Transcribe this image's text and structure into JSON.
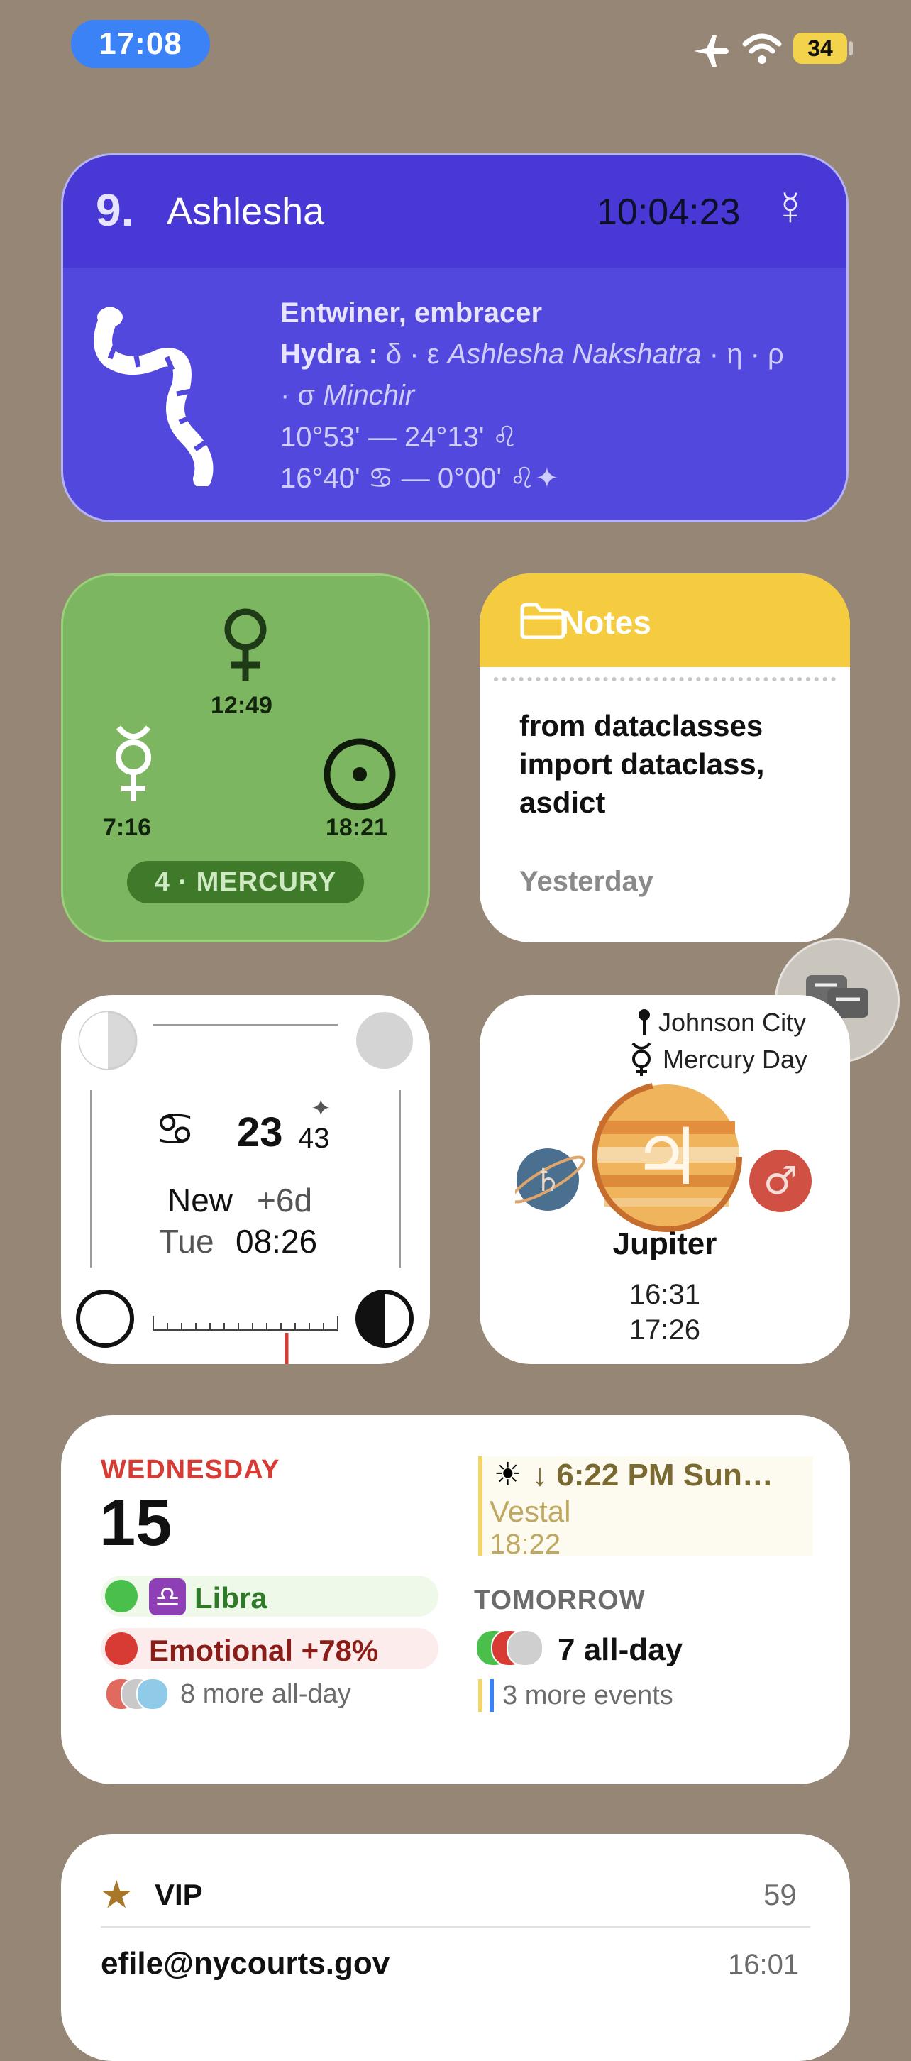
{
  "status_bar": {
    "time": "17:08",
    "battery": "34"
  },
  "nakshatra_widget": {
    "number": "9.",
    "name": "Ashlesha",
    "clock": "10:04:23",
    "planet_symbol": "☿",
    "line1": "Entwiner, embracer",
    "line2_bold": "Hydra :",
    "line2_a": " δ · ε ",
    "line2_italic": "Ashlesha Nakshatra",
    "line2_b": " · η · ρ",
    "line3_a": "· σ ",
    "line3_italic": "Minchir",
    "line4": "10°53' — 24°13' ♌︎",
    "line5": "16°40' ♋︎  —  0°00' ♌︎✦"
  },
  "planet_widget": {
    "top_time": "12:49",
    "left_time": "7:16",
    "right_time": "18:21",
    "badge": "4 · MERCURY"
  },
  "notes_widget": {
    "title": "Notes",
    "body": "from dataclasses import dataclass, asdict",
    "when": "Yesterday"
  },
  "moon_widget": {
    "sign_symbol": "♋︎",
    "degree": "23",
    "minutes": "43",
    "phase": "New",
    "phase_offset": "+6d",
    "weekday": "Tue",
    "time": "08:26"
  },
  "jupiter_widget": {
    "location": "Johnson City",
    "day_label": "Mercury Day",
    "planet_name": "Jupiter",
    "time1": "16:31",
    "time2": "17:26"
  },
  "calendar_widget": {
    "weekday": "WEDNESDAY",
    "date": "15",
    "event1": "Libra",
    "event2": "Emotional +78%",
    "more_today": "8 more all-day",
    "sun_event": "↓ 6:22 PM Sun…",
    "vestal_label": "Vestal",
    "vestal_time": "18:22",
    "tomorrow_label": "TOMORROW",
    "tomorrow_all_day": "7 all-day",
    "tomorrow_more": "3 more events",
    "colors": {
      "red": "#d83a34",
      "green": "#4bbf4b",
      "purple": "#8f3fb5"
    }
  },
  "vip_widget": {
    "title": "VIP",
    "count": "59",
    "sender": "efile@nycourts.gov",
    "time": "16:01"
  }
}
